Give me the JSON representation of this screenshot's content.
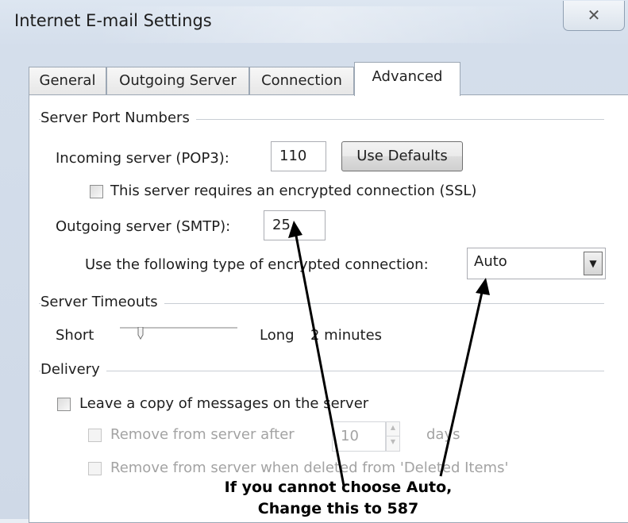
{
  "window": {
    "title": "Internet E-mail Settings",
    "close_glyph": "✕"
  },
  "tabs": [
    {
      "label": "General",
      "active": false
    },
    {
      "label": "Outgoing Server",
      "active": false
    },
    {
      "label": "Connection",
      "active": false
    },
    {
      "label": "Advanced",
      "active": true
    }
  ],
  "server_ports": {
    "group_label": "Server Port Numbers",
    "incoming_label": "Incoming server (POP3):",
    "incoming_value": "110",
    "use_defaults_label": "Use Defaults",
    "ssl_label": "This server requires an encrypted connection (SSL)",
    "ssl_checked": false,
    "outgoing_label": "Outgoing server (SMTP):",
    "outgoing_value": "25",
    "encryption_label": "Use the following type of encrypted connection:",
    "encryption_value": "Auto"
  },
  "timeouts": {
    "group_label": "Server Timeouts",
    "short_label": "Short",
    "long_label": "Long",
    "value_label": "2 minutes"
  },
  "delivery": {
    "group_label": "Delivery",
    "leave_copy_label": "Leave a copy of messages on the server",
    "leave_copy_checked": false,
    "remove_after_label": "Remove from server after",
    "remove_after_days": "10",
    "days_label": "days",
    "remove_deleted_label": "Remove from server when deleted from 'Deleted Items'"
  },
  "annotation": {
    "line1": "If you cannot choose Auto,",
    "line2": "Change this to 587"
  }
}
